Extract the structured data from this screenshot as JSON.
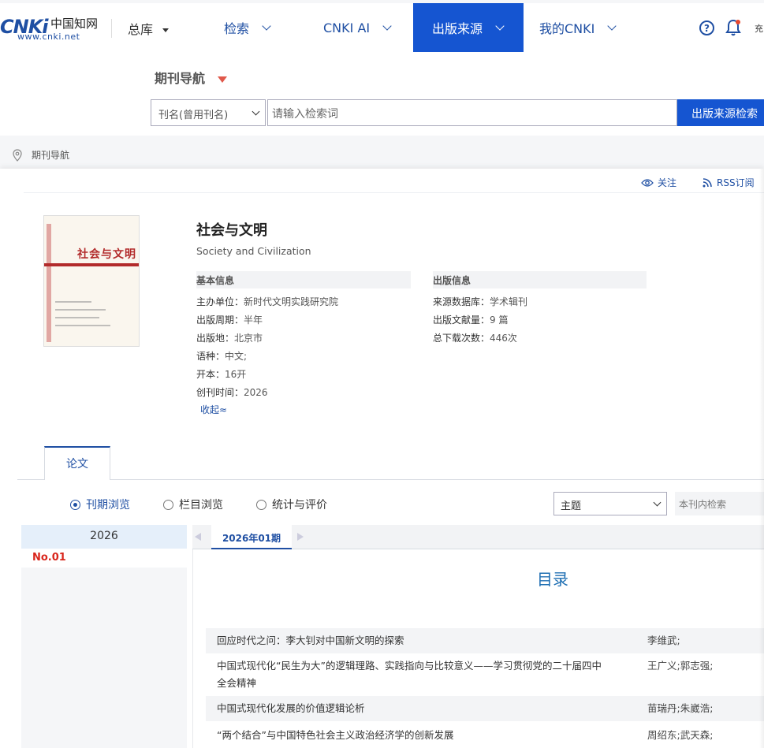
{
  "colors": {
    "brand_blue": "#1555d1",
    "link_blue": "#1f4fa3",
    "accent_red": "#d9261c",
    "title_blue": "#1f6fb3"
  },
  "header": {
    "logo_mark": "CNKi",
    "logo_cn": "中国知网",
    "logo_url": "www.cnki.net",
    "library": "总库",
    "nav": [
      {
        "label": "检索"
      },
      {
        "label": "CNKI AI"
      },
      {
        "label": "出版来源"
      },
      {
        "label": "我的CNKI"
      }
    ],
    "help_glyph": "?",
    "recharge": "充"
  },
  "subheader": {
    "title": "期刊导航",
    "search_field": "刊名(曾用刊名)",
    "search_placeholder": "请输入检索词",
    "search_button": "出版来源检索"
  },
  "breadcrumb": "期刊导航",
  "actions": {
    "follow": "关注",
    "rss": "RSS订阅"
  },
  "journal": {
    "title": "社会与文明",
    "title_en": "Society and Civilization",
    "cover_title": "社会与文明",
    "basic_header": "基本信息",
    "pub_header": "出版信息",
    "basic": [
      {
        "k": "主办单位：",
        "v": "新时代文明实践研究院"
      },
      {
        "k": "出版周期：",
        "v": "半年"
      },
      {
        "k": "出版地：",
        "v": "北京市"
      },
      {
        "k": "语种：",
        "v": "中文;"
      },
      {
        "k": "开本：",
        "v": "16开"
      },
      {
        "k": "创刊时间：",
        "v": "2026"
      }
    ],
    "pub": [
      {
        "k": "来源数据库：",
        "v": "学术辑刊"
      },
      {
        "k": "出版文献量：",
        "v": "9 篇"
      },
      {
        "k": "总下载次数：",
        "v": "446次"
      }
    ],
    "collapse": "收起≈"
  },
  "tabs": {
    "papers": "论文"
  },
  "browse": {
    "options": [
      "刊期浏览",
      "栏目浏览",
      "统计与评价"
    ],
    "selected": 0,
    "topic_select": "主题",
    "in_search_placeholder": "本刊内检索"
  },
  "years": {
    "year": "2026",
    "issue": "No.01"
  },
  "issue_tabs": {
    "current": "2026年01期"
  },
  "toc": {
    "title": "目录",
    "rows": [
      {
        "title_l1": "回应时代之问：李大钊对中国新文明的探索",
        "title_l2": "",
        "authors": "李维武;"
      },
      {
        "title_l1": "中国式现代化“民生为大”的逻辑理路、实践指向与比较意义——学习贯彻党的二十届四中",
        "title_l2": "全会精神",
        "authors": "王广义;郭志强;"
      },
      {
        "title_l1": "中国式现代化发展的价值逻辑论析",
        "title_l2": "",
        "authors": "苗瑞丹;朱崴浩;"
      },
      {
        "title_l1": "“两个结合”与中国特色社会主义政治经济学的创新发展",
        "title_l2": "",
        "authors": "周绍东;武天森;"
      }
    ]
  }
}
